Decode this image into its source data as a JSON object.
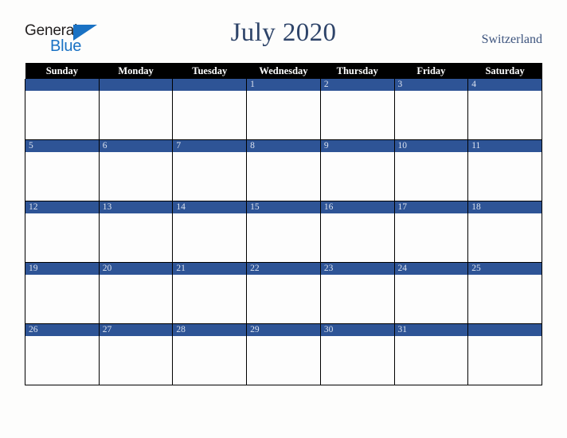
{
  "logo": {
    "word_one": "General",
    "word_two": "Blue",
    "triangle_icon": "triangle-icon",
    "accent_color": "#1a72c4"
  },
  "header": {
    "title": "July 2020",
    "country": "Switzerland",
    "title_color": "#2e4469",
    "country_color": "#3c537d"
  },
  "calendar": {
    "header_background": "#000000",
    "daybar_background": "#2e5496",
    "daybar_text_color": "#dbe2ef",
    "cell_background": "#fdfdfd",
    "weekday_headers": [
      "Sunday",
      "Monday",
      "Tuesday",
      "Wednesday",
      "Thursday",
      "Friday",
      "Saturday"
    ],
    "weeks": [
      [
        "",
        "",
        "",
        "1",
        "2",
        "3",
        "4"
      ],
      [
        "5",
        "6",
        "7",
        "8",
        "9",
        "10",
        "11"
      ],
      [
        "12",
        "13",
        "14",
        "15",
        "16",
        "17",
        "18"
      ],
      [
        "19",
        "20",
        "21",
        "22",
        "23",
        "24",
        "25"
      ],
      [
        "26",
        "27",
        "28",
        "29",
        "30",
        "31",
        ""
      ]
    ]
  }
}
